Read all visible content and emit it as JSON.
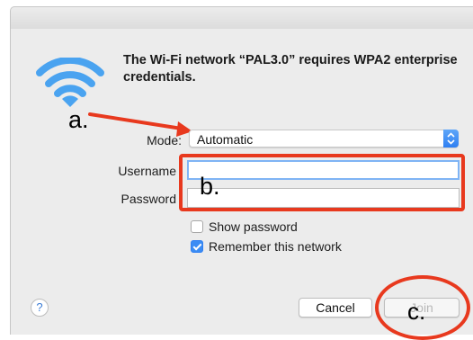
{
  "dialog": {
    "message": "The Wi-Fi network “PAL3.0” requires WPA2 enterprise credentials."
  },
  "form": {
    "mode_label": "Mode:",
    "mode_value": "Automatic",
    "username_label": "Username",
    "username_value": "",
    "password_label": "Password",
    "password_value": ""
  },
  "options": {
    "show_password_label": "Show password",
    "show_password_checked": false,
    "remember_label": "Remember this network",
    "remember_checked": true
  },
  "buttons": {
    "help_label": "?",
    "cancel_label": "Cancel",
    "join_label": "Join"
  },
  "annotations": {
    "a": "a.",
    "b": "b.",
    "c": "c."
  },
  "icons": {
    "wifi": "wifi-icon",
    "stepper": "up-down-stepper-icon",
    "checkmark": "checkmark-icon"
  },
  "colors": {
    "accent": "#3b8cf4",
    "wifi_icon": "#4aa3f0",
    "annotation": "#e8391e",
    "sheet_background": "#ececec"
  }
}
